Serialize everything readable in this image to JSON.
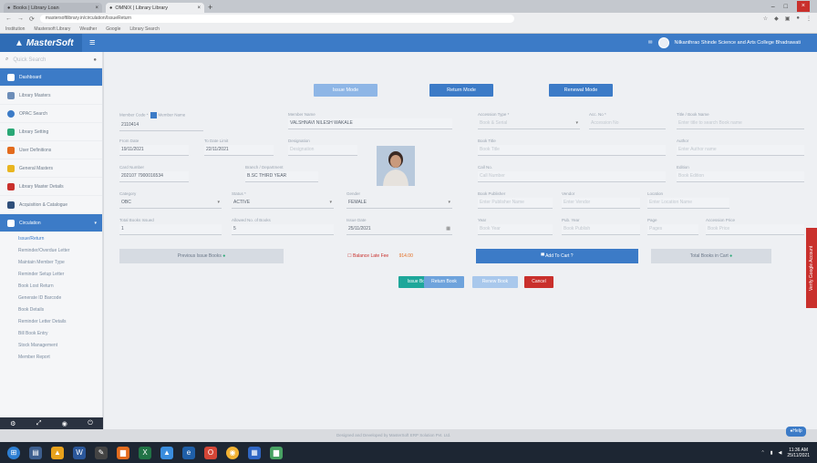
{
  "browser": {
    "tabs": [
      {
        "label": "Books | Library Loan"
      },
      {
        "label": "OMNIX | Library Library"
      }
    ],
    "new_tab": "+",
    "url": "mastersoftlibrary.in/circulation/IssueReturn",
    "bookmarks": [
      "Institution",
      "Mastersoft Library",
      "Weather",
      "Google",
      "Library Search"
    ]
  },
  "app": {
    "logo": "MasterSoft",
    "menu_icon": "≡",
    "institution": "Nilkanthrao Shinde Science and Arts College Bhadrawati"
  },
  "sidebar": {
    "search_placeholder": "Quick Search",
    "items": [
      {
        "label": "Dashboard",
        "icon": "dashboard-icon"
      },
      {
        "label": "Library Masters",
        "icon": "list-icon"
      },
      {
        "label": "OPAC Search",
        "icon": "search-icon"
      },
      {
        "label": "Library Setting",
        "icon": "gear-icon"
      },
      {
        "label": "User Definitions",
        "icon": "user-icon"
      },
      {
        "label": "General Masters",
        "icon": "folder-icon"
      },
      {
        "label": "Library Master Details",
        "icon": "people-icon"
      },
      {
        "label": "Acquisition & Catalogue",
        "icon": "book-icon"
      },
      {
        "label": "Circulation",
        "icon": "circulation-icon"
      }
    ],
    "sub_items": [
      "Issue/Return",
      "Reminder/Overdue Letter",
      "Maintain Member Type",
      "Reminder Setup Letter",
      "Book Lost Return",
      "Generate ID Barcode",
      "Book Details",
      "Reminder Letter Details",
      "Bill Book Entry",
      "Stock Management",
      "Member Report"
    ]
  },
  "modes": {
    "issue": "Issue Mode",
    "return": "Return Mode",
    "renewal": "Renewal Mode"
  },
  "form": {
    "member_code_label": "Member Code *",
    "member_code_checkbox": "Member Name",
    "member_code": "2110414",
    "member_name_label": "Member Name",
    "member_name": "VALSHNAVI NILESH WAKALE",
    "accession_type_label": "Accession Type *",
    "accession_type": "Book & Serial",
    "accession_no_label": "Acc. No *",
    "accession_no": "Accession No",
    "title_label": "Title / Book Name",
    "title": "Enter title to search Book name",
    "from_date_label": "From Date",
    "from_date": "19/11/2021",
    "to_date_label": "To Date Limit",
    "to_date": "22/11/2021",
    "designation_label": "Designation",
    "designation": "Designation",
    "book_title_label": "Book Title",
    "book_title": "Book Title",
    "author_label": "Author",
    "author": "Enter Author name",
    "card_no_label": "Card Number",
    "card_no": "202107 7900016534",
    "department_label": "Branch / Department",
    "department": "B.SC THIRD YEAR",
    "call_no_label": "Call No.",
    "call_no": "Call Number",
    "edition_label": "Edition",
    "edition": "Book Edition",
    "category_label": "Category",
    "category": "OBC",
    "status_label": "Status *",
    "status": "ACTIVE",
    "gender_label": "Gender",
    "gender": "FEMALE",
    "publisher_label": "Book Publisher",
    "publisher": "Enter Publisher Name",
    "vendor_label": "Vendor",
    "vendor": "Enter Vendor",
    "location_label": "Location",
    "location": "Enter Location Name",
    "books_issued_label": "Total Books Issued",
    "books_issued": "1",
    "allowed_books_label": "Allowed No. of Books",
    "allowed_books": "5",
    "issue_date_label": "Issue Date",
    "issue_date": "25/11/2021",
    "year_label": "Year",
    "year": "Book Year",
    "edition2_label": "Pub. Year",
    "edition2": "Book Publish",
    "page_label": "Page",
    "page": "Pages",
    "accession_price_label": "Accession Price",
    "accession_price": "Book Price"
  },
  "bar": {
    "previous_issue": "Previous Issue Books",
    "balance_label": "Balance Late Fee",
    "balance_value": "914.00",
    "add_to_cart": "Add To Cart ?",
    "total_books_cart": "Total Books in Cart"
  },
  "actions": {
    "issue": "Issue Book",
    "return": "Return Book",
    "renew": "Renew Book",
    "cancel": "Cancel"
  },
  "footer": "Designed and Developed by MasterSoft ERP Solution Pvt. Ltd.",
  "help": "Help",
  "side_tab": "Verify Google Account",
  "taskbar": {
    "time": "11:36 AM",
    "date": "25/11/2021"
  },
  "colors": {
    "primary": "#3c7bc7",
    "danger": "#c9302c",
    "teal": "#1ea79a",
    "sidebar_bg": "#f5f6f8"
  }
}
